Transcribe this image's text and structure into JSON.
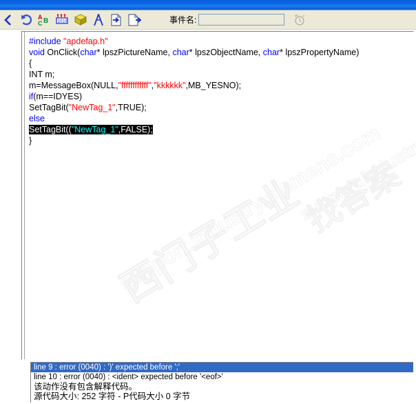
{
  "window": {
    "titlebar_color": "#0a64e6",
    "toolbar_bg": "#ece9d8"
  },
  "toolbar": {
    "icons": [
      {
        "name": "back-chevron-icon",
        "label": "‹"
      },
      {
        "name": "undo-icon",
        "label": "Undo"
      },
      {
        "name": "abc-sort-icon",
        "label": "A C B"
      },
      {
        "name": "binary-counter-icon",
        "label": "1010"
      },
      {
        "name": "yellow-cube-icon",
        "label": "Object"
      },
      {
        "name": "compass-icon",
        "label": "Compass"
      },
      {
        "name": "import-page-icon",
        "label": "Import"
      },
      {
        "name": "export-page-icon",
        "label": "Export"
      }
    ],
    "event_label": "事件名:",
    "event_value": "",
    "event_placeholder": "",
    "clock_icon": "alarm-clock-icon"
  },
  "editor": {
    "lines": [
      {
        "id": 1,
        "tokens": [
          {
            "t": "#include ",
            "c": "kw"
          },
          {
            "t": "\"apdefap.h\"",
            "c": "str"
          }
        ]
      },
      {
        "id": 2,
        "tokens": [
          {
            "t": "void",
            "c": "kw"
          },
          {
            "t": " OnClick(",
            "c": "pl"
          },
          {
            "t": "char",
            "c": "kw"
          },
          {
            "t": "* lpszPictureName, ",
            "c": "pl"
          },
          {
            "t": "char",
            "c": "kw"
          },
          {
            "t": "* lpszObjectName, ",
            "c": "pl"
          },
          {
            "t": "char",
            "c": "kw"
          },
          {
            "t": "* lpszPropertyName)",
            "c": "pl"
          }
        ]
      },
      {
        "id": 3,
        "tokens": [
          {
            "t": "{",
            "c": "pl"
          }
        ]
      },
      {
        "id": 4,
        "tokens": [
          {
            "t": "INT m;",
            "c": "pl"
          }
        ]
      },
      {
        "id": 5,
        "tokens": [
          {
            "t": "m=MessageBox(NULL,",
            "c": "pl"
          },
          {
            "t": "\"ffffffffffff\"",
            "c": "str"
          },
          {
            "t": ",",
            "c": "pl"
          },
          {
            "t": "\"kkkkkk\"",
            "c": "str"
          },
          {
            "t": ",MB_YESNO);",
            "c": "pl"
          }
        ]
      },
      {
        "id": 6,
        "tokens": [
          {
            "t": "if",
            "c": "kw"
          },
          {
            "t": "(m==IDYES)",
            "c": "pl"
          }
        ]
      },
      {
        "id": 7,
        "tokens": [
          {
            "t": "SetTagBit(",
            "c": "pl"
          },
          {
            "t": "\"NewTag_1\"",
            "c": "str"
          },
          {
            "t": ",TRUE);",
            "c": "pl"
          }
        ]
      },
      {
        "id": 8,
        "tokens": [
          {
            "t": "else",
            "c": "kw"
          }
        ]
      },
      {
        "id": 9,
        "selected": true,
        "tokens": [
          {
            "t": "SetTagBit((",
            "c": "pl"
          },
          {
            "t": "\"NewTag_1\"",
            "c": "selstr"
          },
          {
            "t": ",FALSE);",
            "c": "pl"
          }
        ]
      },
      {
        "id": 10,
        "tokens": [
          {
            "t": "}",
            "c": "pl"
          }
        ]
      }
    ]
  },
  "watermark": {
    "line1": "西门子工业",
    "line2": "support.industry.siemens.com",
    "line3": "找答案",
    "line4": "support.industry.siemens.com/cs"
  },
  "output": {
    "lines": [
      {
        "text": "line 9 : error (0040) : ')' expected before ';'",
        "selected": true,
        "cn": false
      },
      {
        "text": "line 10 : error (0040) : <ident> expected before '<eof>'",
        "selected": false,
        "cn": false
      },
      {
        "text": "该动作没有包含解释代码。",
        "selected": false,
        "cn": true
      },
      {
        "text": "源代码大小: 252 字符 - P代码大小 0 字节",
        "selected": false,
        "cn": true
      }
    ]
  }
}
